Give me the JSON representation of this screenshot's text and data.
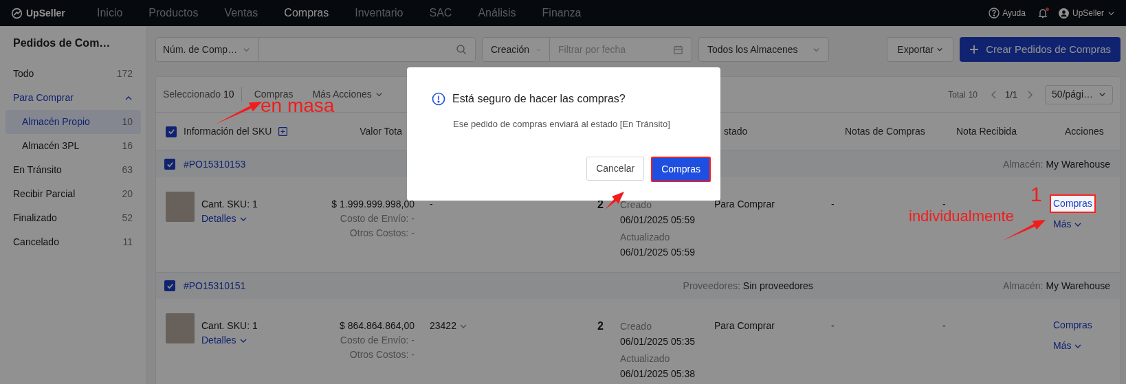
{
  "top_nav": {
    "logo": "UpSeller",
    "items": [
      {
        "label": "Inicio",
        "selected": false
      },
      {
        "label": "Productos",
        "selected": false
      },
      {
        "label": "Ventas",
        "selected": false
      },
      {
        "label": "Compras",
        "selected": true
      },
      {
        "label": "Inventario",
        "selected": false
      },
      {
        "label": "SAC",
        "selected": false
      },
      {
        "label": "Análisis",
        "selected": false
      },
      {
        "label": "Finanza",
        "selected": false
      }
    ],
    "help": "Ayuda",
    "has_notification": true,
    "user": "UpSeller"
  },
  "sidebar": {
    "title": "Pedidos de Com…",
    "items": [
      {
        "label": "Todo",
        "count": "172",
        "selected": false
      },
      {
        "label": "Para Comprar",
        "expanded": true,
        "selected": false,
        "children": [
          {
            "label": "Almacén Propio",
            "count": "10",
            "selected": true
          },
          {
            "label": "Almacén 3PL",
            "count": "16",
            "selected": false
          }
        ]
      },
      {
        "label": "En Tránsito",
        "count": "63",
        "selected": false
      },
      {
        "label": "Recibir Parcial",
        "count": "20",
        "selected": false
      },
      {
        "label": "Finalizado",
        "count": "52",
        "selected": false
      },
      {
        "label": "Cancelado",
        "count": "11",
        "selected": false
      }
    ]
  },
  "filters": {
    "search_type": "Núm. de Comp…",
    "date_type": "Creación",
    "date_placeholder": "Filtrar por fecha",
    "warehouse": "Todos los Almacenes",
    "export": "Exportar",
    "create": "Crear Pedidos de Compras"
  },
  "toolbar": {
    "selected_label": "Seleccionado",
    "selected_count": "10",
    "bulk_action": "Compras",
    "more_actions": "Más Acciones",
    "total_label": "Total",
    "total": "10",
    "page": "1/1",
    "page_size": "50/pági…"
  },
  "table": {
    "select_all": true,
    "columns": [
      {
        "label": "Información del SKU"
      },
      {
        "label": "Valor Tota"
      },
      {
        "label": "stado"
      },
      {
        "label": "Notas de Compras"
      },
      {
        "label": "Nota Recibida"
      },
      {
        "label": "Acciones"
      }
    ],
    "orders": [
      {
        "id": "#PO15310153",
        "checked": true,
        "warehouse_label": "Almacén:",
        "warehouse": "My Warehouse",
        "sku_count": "Cant. SKU: 1",
        "details": "Detalles",
        "value": "$ 1.999.999.998,00",
        "shipping": "Costo de Envío: -",
        "other_costs": "Otros Costos: -",
        "column_3": "-",
        "column_3_dropdown": false,
        "quantity": "2",
        "created_label": "Creado",
        "created": "06/01/2025 05:59",
        "updated_label": "Actualizado",
        "updated": "06/01/2025 05:59",
        "status": "Para Comprar",
        "purchase_notes": "-",
        "receipt_note": "-",
        "action": "Compras",
        "action_highlighted": true,
        "more": "Más"
      },
      {
        "id": "#PO15310151",
        "checked": true,
        "supplier_label": "Proveedores:",
        "supplier": "Sin proveedores",
        "warehouse_label": "Almacén:",
        "warehouse": "My Warehouse",
        "sku_count": "Cant. SKU: 1",
        "details": "Detalles",
        "value": "$ 864.864.864,00",
        "shipping": "Costo de Envío: -",
        "other_costs": "Otros Costos: -",
        "column_3": "23422",
        "column_3_dropdown": true,
        "quantity": "2",
        "created_label": "Creado",
        "created": "06/01/2025 05:35",
        "updated_label": "Actualizado",
        "updated": "06/01/2025 05:38",
        "status": "Para Comprar",
        "purchase_notes": "-",
        "receipt_note": "-",
        "action": "Compras",
        "action_highlighted": false,
        "more": "Más"
      }
    ]
  },
  "modal": {
    "title": "Está seguro de hacer las compras?",
    "message": "Ese pedido de compras enviará al estado [En Tránsito]",
    "cancel": "Cancelar",
    "confirm": "Compras",
    "confirm_highlighted": true
  },
  "annotations": [
    {
      "kind": "label",
      "text": "en masa"
    },
    {
      "kind": "label",
      "text": "individualmente"
    },
    {
      "kind": "number",
      "text": "1"
    }
  ]
}
